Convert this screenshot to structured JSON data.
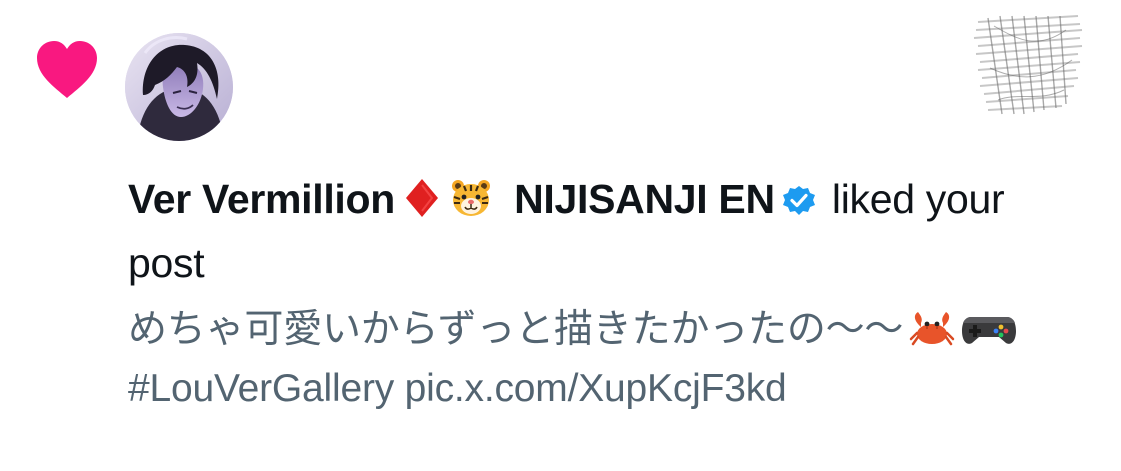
{
  "notification": {
    "type_icon": "heart-icon",
    "accent_color": "#f91880",
    "avatar_icon": "user-avatar",
    "author": {
      "name": "Ver Vermillion",
      "emoji_1": "diamond-suit-emoji",
      "emoji_2": "tiger-face-emoji",
      "org": "NIJISANJI EN",
      "verified_icon": "verified-badge-icon",
      "verified_color": "#1d9bf0"
    },
    "action_text": "liked your post",
    "post_preview": {
      "text_before_emoji": "めちゃ可愛いからずっと描きたかったの～～",
      "emoji_1": "crab-emoji",
      "emoji_2": "video-game-controller-emoji",
      "hashtag": "#LouVerGallery",
      "link": "pic.x.com/XupKcjF3kd"
    }
  },
  "colors": {
    "primary_text": "#0f1419",
    "secondary_text": "#536471",
    "background": "#ffffff"
  }
}
